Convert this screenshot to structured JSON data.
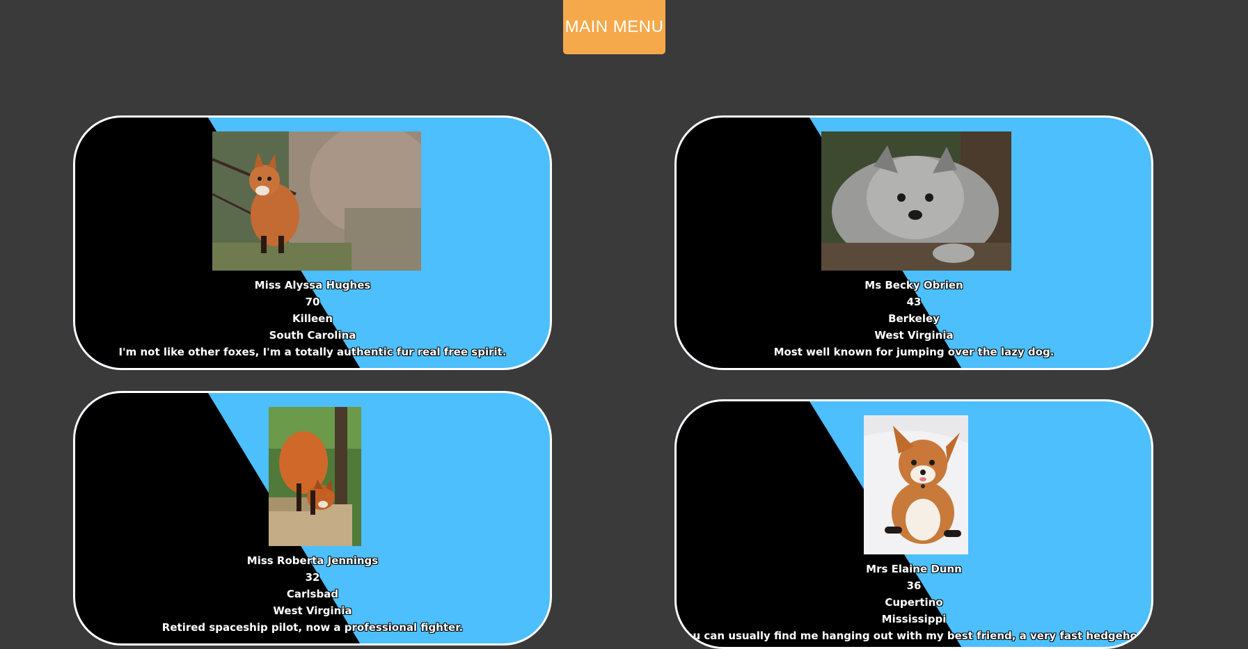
{
  "header": {
    "menu_label": "MAIN MENU"
  },
  "colors": {
    "background": "#3a3a3a",
    "accent": "#f5a94a",
    "card_blue": "#4cbffc",
    "card_black": "#000000",
    "card_border": "#ffffff"
  },
  "cards": [
    {
      "photo": "red-fox-kit-on-rocks-image",
      "name": "Miss Alyssa Hughes",
      "age": "70",
      "city": "Killeen",
      "state": "South Carolina",
      "bio": "I'm not like other foxes, I'm a totally authentic fur real free spirit."
    },
    {
      "photo": "grey-arctic-fox-on-log-image",
      "name": "Ms Becky Obrien",
      "age": "43",
      "city": "Berkeley",
      "state": "West Virginia",
      "bio": "Most well known for jumping over the lazy dog."
    },
    {
      "photo": "red-fox-on-wooden-steps-image",
      "name": "Miss Roberta Jennings",
      "age": "32",
      "city": "Carlsbad",
      "state": "West Virginia",
      "bio": "Retired spaceship pilot, now a professional fighter."
    },
    {
      "photo": "fox-lying-on-white-blanket-image",
      "name": "Mrs Elaine Dunn",
      "age": "36",
      "city": "Cupertino",
      "state": "Mississippi",
      "bio": "You can usually find me hanging out with my best friend, a very fast hedgehog."
    }
  ]
}
